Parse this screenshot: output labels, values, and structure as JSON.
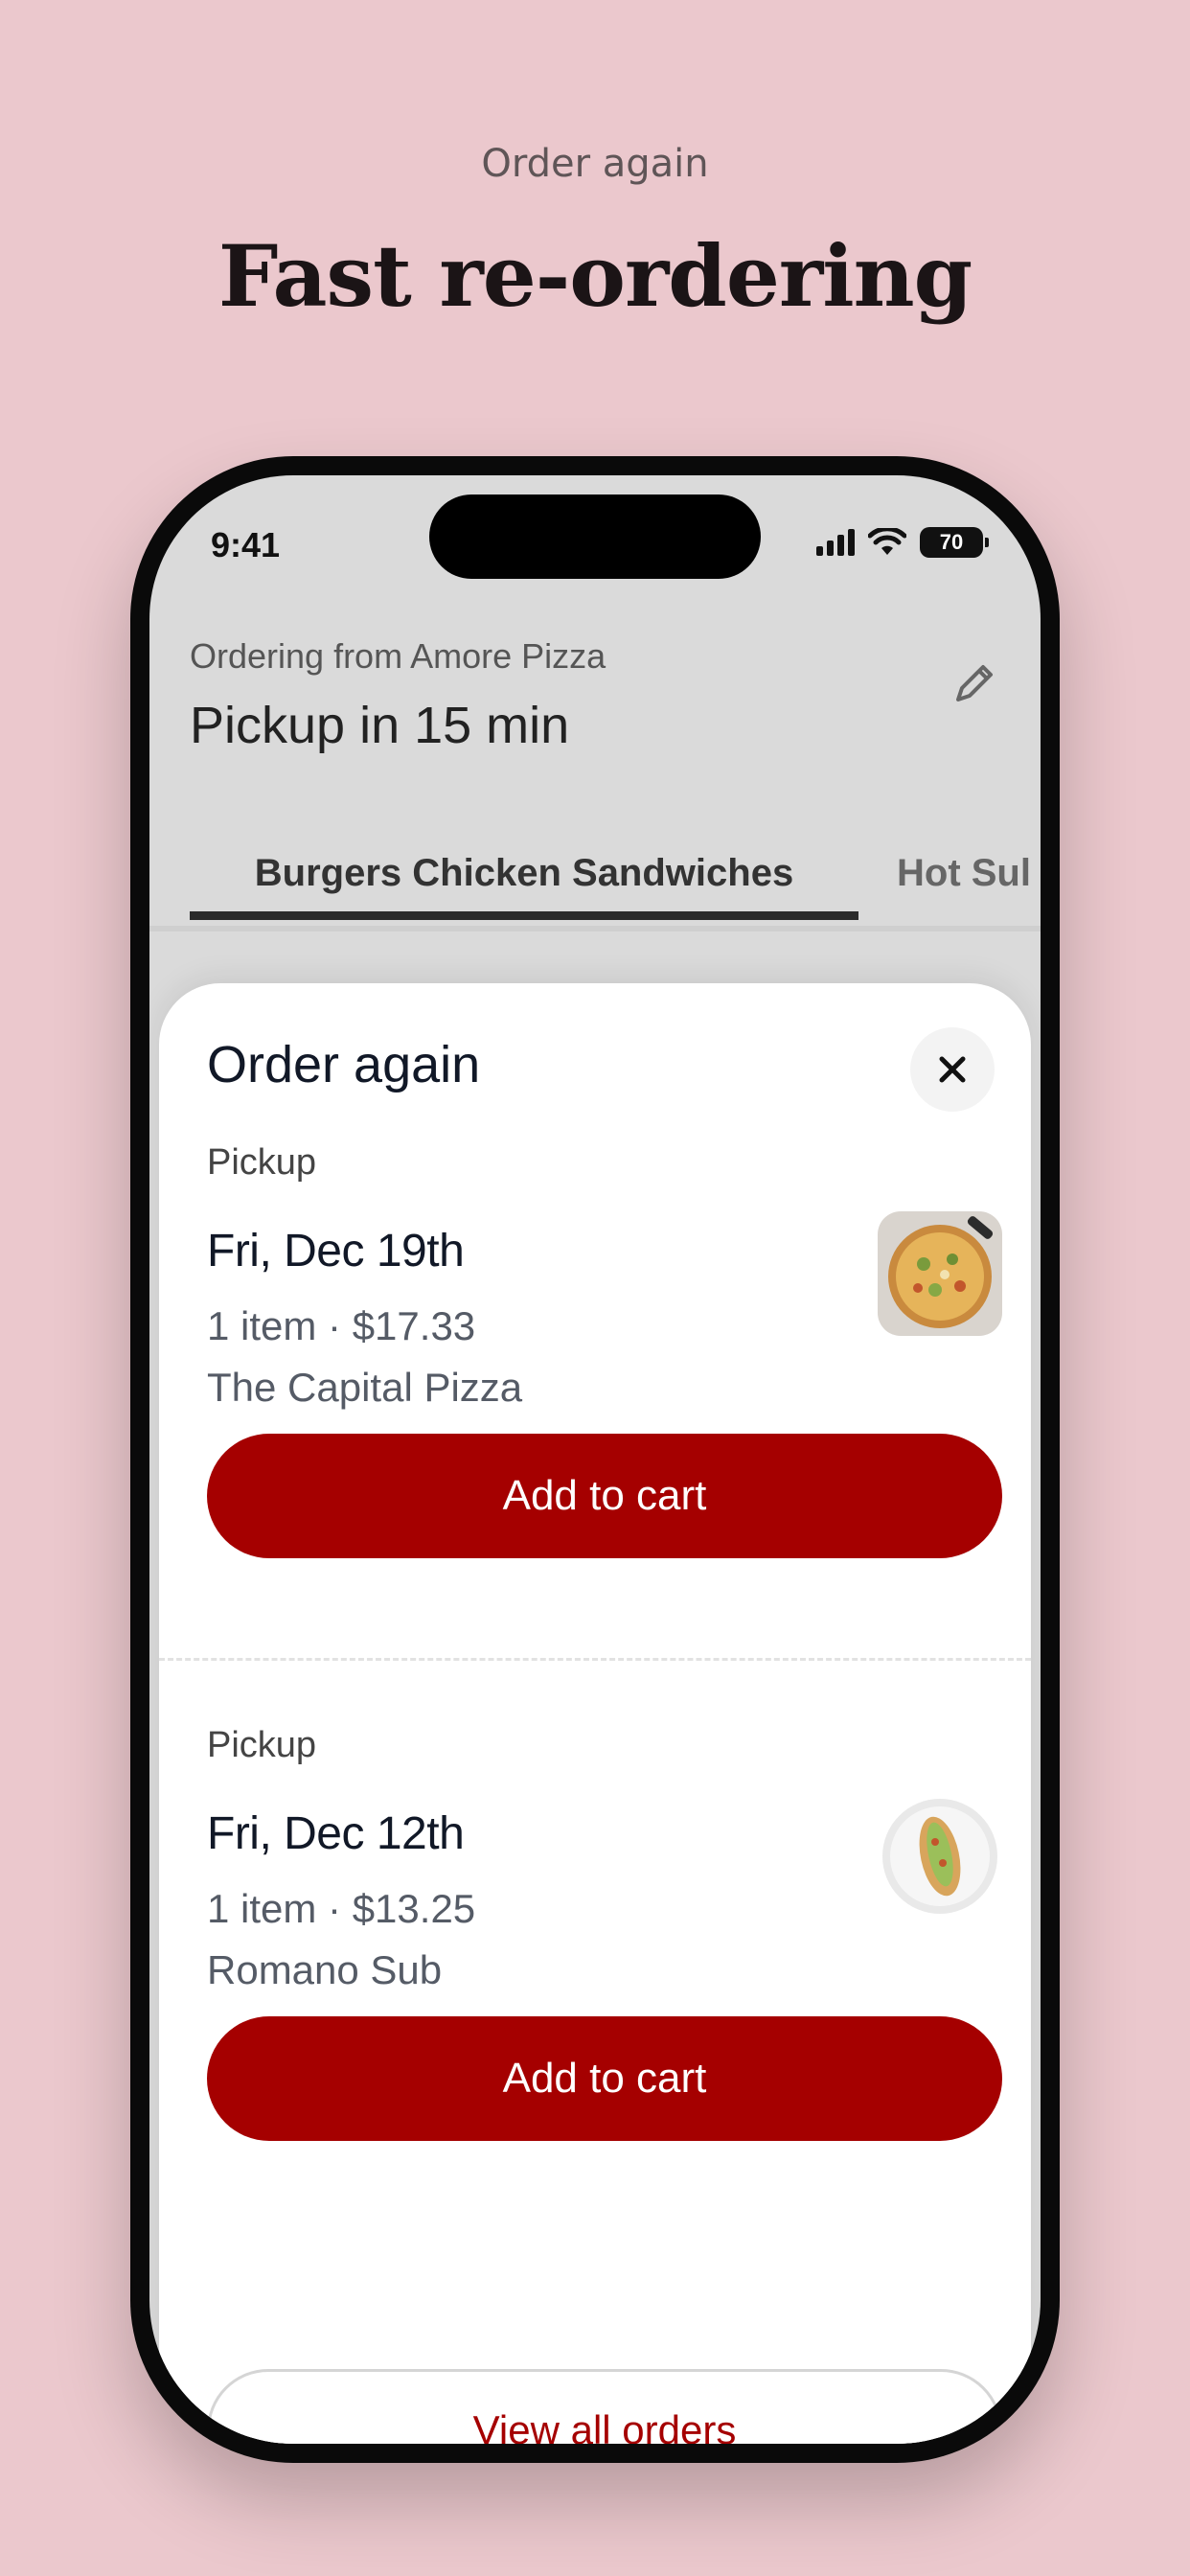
{
  "promo": {
    "eyebrow": "Order again",
    "title": "Fast re-ordering"
  },
  "status_bar": {
    "time": "9:41",
    "battery": "70"
  },
  "header": {
    "ordering_from": "Ordering from Amore Pizza",
    "pickup_time": "Pickup in 15 min",
    "edit_icon": "pencil-icon"
  },
  "tabs": [
    {
      "label": "Burgers Chicken Sandwiches",
      "active": true
    },
    {
      "label": "Hot Sul",
      "active": false
    }
  ],
  "sheet": {
    "title": "Order again",
    "close_icon": "close-icon",
    "orders": [
      {
        "type": "Pickup",
        "date": "Fri, Dec 19th",
        "meta": "1 item · $17.33",
        "store": "The Capital Pizza",
        "button": "Add to cart",
        "thumb": "pizza"
      },
      {
        "type": "Pickup",
        "date": "Fri, Dec 12th",
        "meta": "1 item · $13.25",
        "store": "Romano Sub",
        "button": "Add to cart",
        "thumb": "sub-sandwich"
      }
    ],
    "view_all": "View all orders"
  },
  "colors": {
    "background": "#ebc8cd",
    "accent": "#a50000"
  }
}
